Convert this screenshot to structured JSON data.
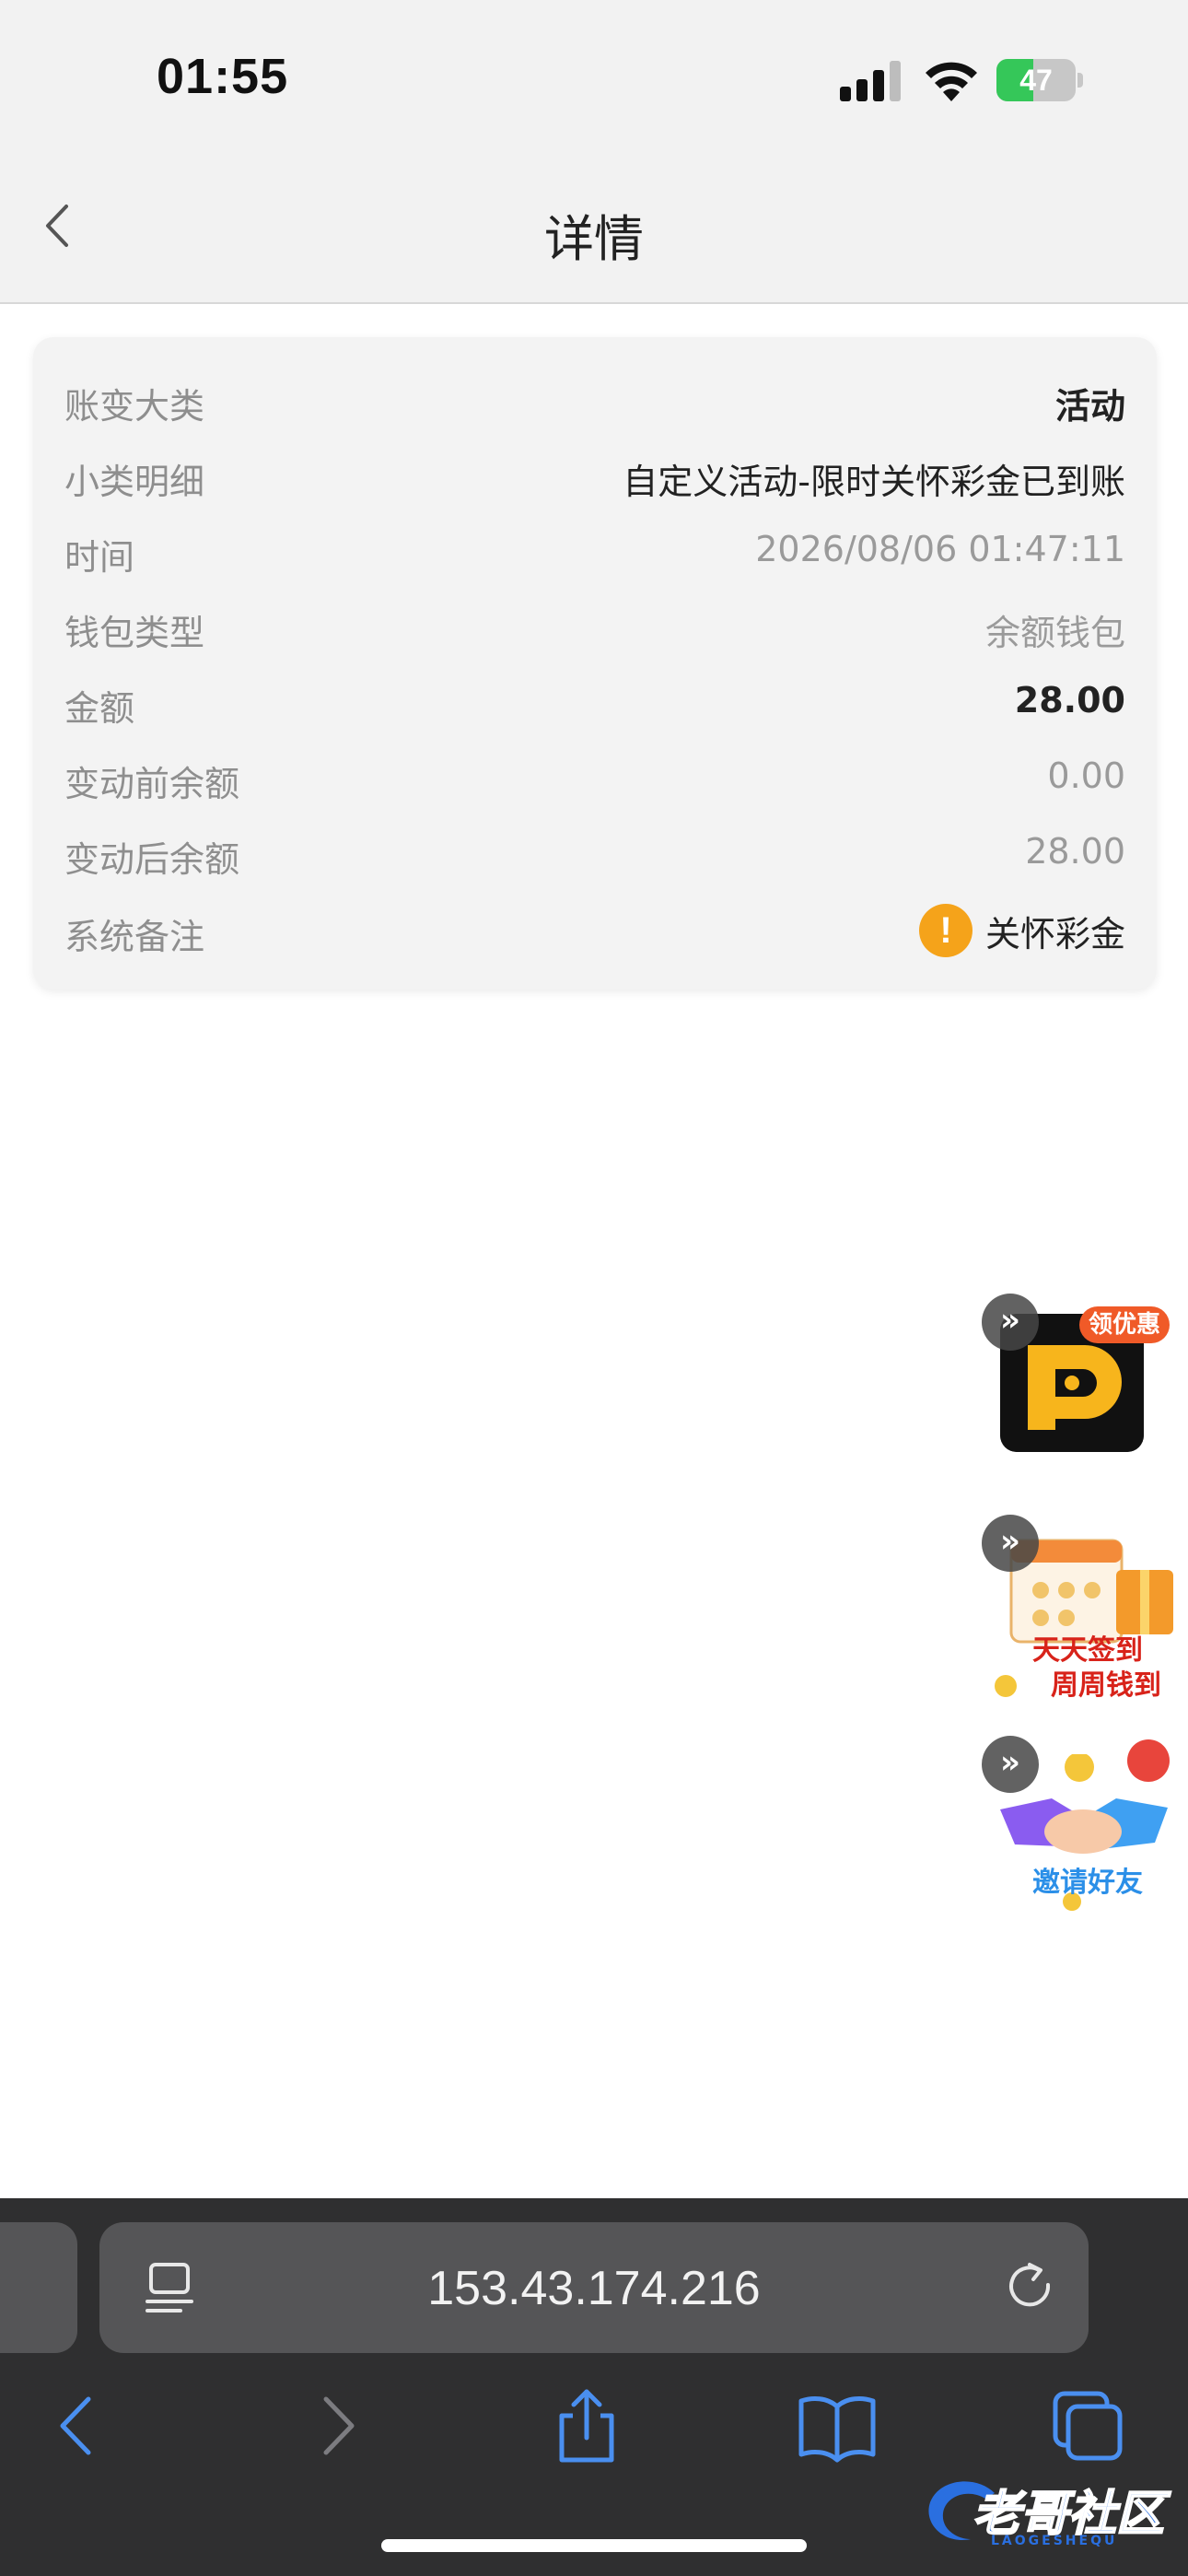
{
  "status_bar": {
    "time": "01:55",
    "battery_percent": "47",
    "battery_level": 0.47
  },
  "nav": {
    "title": "详情"
  },
  "details": {
    "rows": [
      {
        "label": "账变大类",
        "value": "活动"
      },
      {
        "label": "小类明细",
        "value": "自定义活动-限时关怀彩金已到账"
      },
      {
        "label": "时间",
        "value": "2026/08/06 01:47:11"
      },
      {
        "label": "钱包类型",
        "value": "余额钱包"
      },
      {
        "label": "金额",
        "value": "28.00"
      },
      {
        "label": "变动前余额",
        "value": "0.00"
      },
      {
        "label": "变动后余额",
        "value": "28.00"
      },
      {
        "label": "系统备注",
        "value": "关怀彩金"
      }
    ],
    "remark_icon": "!"
  },
  "floating": {
    "promo_badge": "领优惠",
    "checkin_line1": "天天签到",
    "checkin_line2": "周周钱到",
    "invite_label": "邀请好友",
    "collapse_glyph": "»"
  },
  "browser": {
    "address": "153.43.174.216"
  },
  "watermark": {
    "text": "老哥社区",
    "sub": "LAOGESHEQU"
  },
  "colors": {
    "warning": "#f5a31a",
    "battery_green": "#35c759",
    "browser_bg": "#2f2f30",
    "tool_blue": "#4a8ff0"
  }
}
